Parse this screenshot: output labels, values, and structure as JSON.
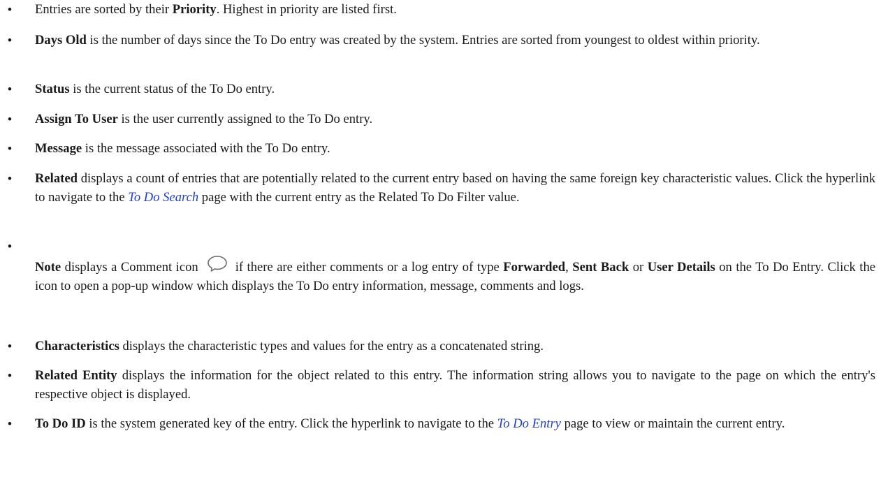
{
  "bullet_char": "•",
  "items": [
    {
      "parts": [
        {
          "t": "Entries are sorted by their "
        },
        {
          "b": "Priority"
        },
        {
          "t": ". Highest in priority are listed first."
        }
      ]
    },
    {
      "parts": [
        {
          "b": "Days Old"
        },
        {
          "t": " is the number of days since the To Do entry was created by the system. Entries are sorted from youngest to oldest within priority."
        }
      ]
    },
    {
      "parts": [
        {
          "b": "Status"
        },
        {
          "t": " is the current status of the To Do entry."
        }
      ]
    },
    {
      "parts": [
        {
          "b": "Assign To User"
        },
        {
          "t": " is the user currently assigned to the To Do entry."
        }
      ]
    },
    {
      "parts": [
        {
          "b": "Message"
        },
        {
          "t": " is the message associated with the To Do entry."
        }
      ]
    },
    {
      "parts": [
        {
          "b": "Related"
        },
        {
          "t": " displays a count of entries that are potentially related to the current entry based on having the same foreign key characteristic values. Click the hyperlink to navigate to the "
        },
        {
          "link": "To Do Search",
          "name": "to-do-search-link"
        },
        {
          "t": " page with the current entry as the Related To Do Filter value."
        }
      ]
    },
    {
      "parts": [
        {
          "b": "Note"
        },
        {
          "t": " displays a Comment icon "
        },
        {
          "icon": "comment-icon"
        },
        {
          "t": " if there are either comments or a log entry of type "
        },
        {
          "b": "Forwarded"
        },
        {
          "t": ", "
        },
        {
          "b": "Sent Back"
        },
        {
          "t": " or "
        },
        {
          "b": "User Details"
        },
        {
          "t": " on the To Do Entry. Click the icon to open a pop-up window which displays the To Do entry information, message, comments and logs."
        }
      ]
    },
    {
      "parts": [
        {
          "b": "Characteristics"
        },
        {
          "t": " displays the characteristic types and values for the entry as a concatenated string."
        }
      ]
    },
    {
      "parts": [
        {
          "b": "Related Entity"
        },
        {
          "t": " displays the information for the object related to this entry. The information string allows you to navigate to the page on which the entry's respective object is displayed."
        }
      ]
    },
    {
      "parts": [
        {
          "b": "To Do ID"
        },
        {
          "t": " is the system generated key of the entry. Click the hyperlink to navigate to the "
        },
        {
          "link": "To Do Entry",
          "name": "to-do-entry-link"
        },
        {
          "t": " page to view or maintain the current entry."
        }
      ]
    }
  ]
}
